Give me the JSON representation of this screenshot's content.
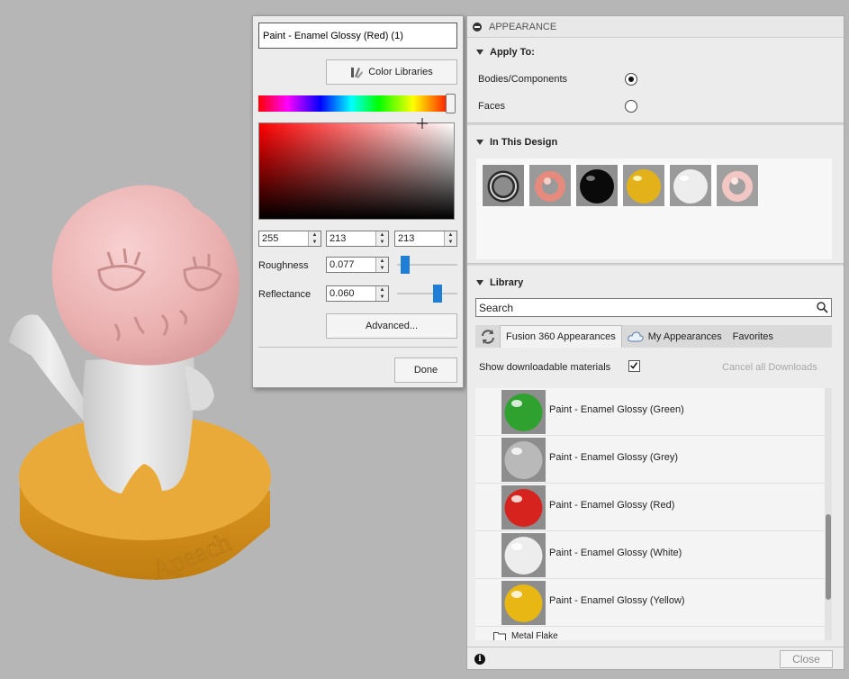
{
  "colors": {
    "viewport_bg": "#b6b6b6",
    "panel_bg": "#ececec",
    "accent": "#1f7fd6",
    "head": "#f1b9b9",
    "base": "#e5a432",
    "body": "#e4e4e4"
  },
  "viewport": {
    "model_text": "Apeach"
  },
  "color_editor": {
    "name_value": "Paint - Enamel Glossy (Red) (1)",
    "color_libraries_label": "Color Libraries",
    "rgb": {
      "r": "255",
      "g": "213",
      "b": "213"
    },
    "roughness_label": "Roughness",
    "roughness_value": "0.077",
    "roughness_level": 0.077,
    "reflectance_label": "Reflectance",
    "reflectance_value": "0.060",
    "reflectance_level": 0.7,
    "advanced_label": "Advanced...",
    "done_label": "Done"
  },
  "appearance": {
    "header_title": "APPEARANCE",
    "apply_to": {
      "title": "Apply To:",
      "options": [
        {
          "label": "Bodies/Components",
          "selected": true
        },
        {
          "label": "Faces",
          "selected": false
        }
      ]
    },
    "in_design": {
      "title": "In This Design",
      "swatches": [
        "chrome-torus-icon",
        "pink-torus-icon",
        "black-sphere-icon",
        "yellow-sphere-icon",
        "white-sphere-icon",
        "light-pink-torus-icon"
      ]
    },
    "library": {
      "title": "Library",
      "search_value": "Search",
      "tabs": [
        "Fusion 360 Appearances",
        "My Appearances",
        "Favorites"
      ],
      "show_downloadable_label": "Show downloadable materials",
      "show_downloadable_checked": true,
      "cancel_downloads_label": "Cancel all Downloads",
      "materials": [
        {
          "label": "Paint - Enamel Glossy (Green)",
          "color": "#2fa12f"
        },
        {
          "label": "Paint - Enamel Glossy (Grey)",
          "color": "#b9b9b9"
        },
        {
          "label": "Paint - Enamel Glossy (Red)",
          "color": "#d6231d"
        },
        {
          "label": "Paint - Enamel Glossy (White)",
          "color": "#ededed"
        },
        {
          "label": "Paint - Enamel Glossy (Yellow)",
          "color": "#e9b713"
        }
      ],
      "folder_label": "Metal Flake"
    },
    "close_label": "Close"
  }
}
